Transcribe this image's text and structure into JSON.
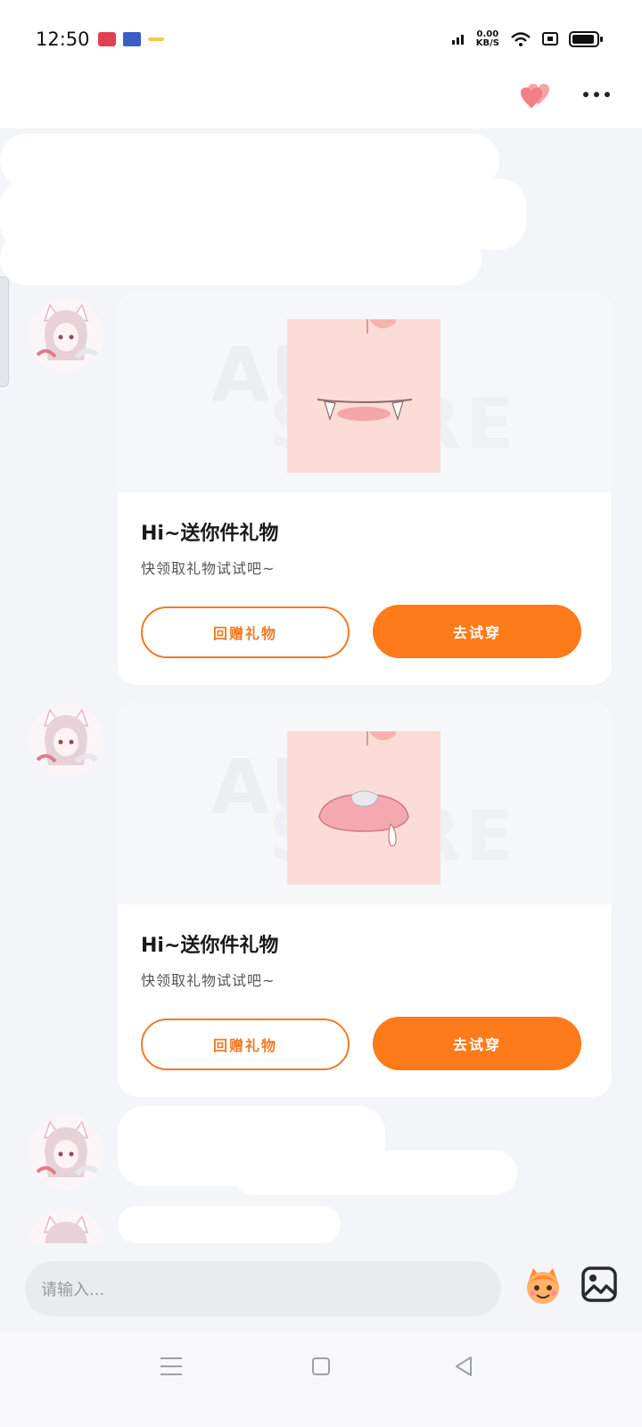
{
  "status_bar": {
    "time": "12:50",
    "net_speed_top": "0.00",
    "net_speed_unit": "KB/S"
  },
  "chat": {
    "gift_cards": [
      {
        "title": "Hi~送你件礼物",
        "subtitle": "快领取礼物试试吧~",
        "return_gift_label": "回赠礼物",
        "try_on_label": "去试穿",
        "item": "fang-mouth"
      },
      {
        "title": "Hi~送你件礼物",
        "subtitle": "快领取礼物试试吧~",
        "return_gift_label": "回赠礼物",
        "try_on_label": "去试穿",
        "item": "drool-mouth"
      }
    ]
  },
  "input": {
    "placeholder": "请输入..."
  },
  "colors": {
    "accent": "#ff7a18",
    "accent_outline": "#f07a25",
    "background": "#f3f5f8"
  }
}
